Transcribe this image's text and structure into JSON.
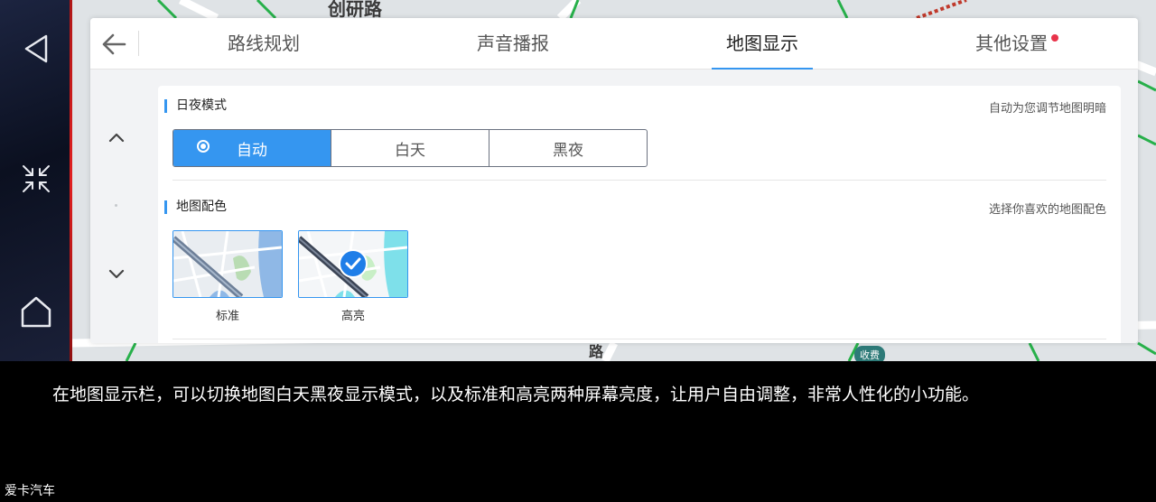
{
  "map": {
    "road_label_top": "创研路",
    "road_label_bottom": "路",
    "toll_badge": "收费"
  },
  "sidebar": {
    "buttons": [
      {
        "icon": "back-triangle-icon"
      },
      {
        "icon": "shrink-arrows-icon"
      },
      {
        "icon": "home-icon"
      }
    ]
  },
  "header": {
    "back_icon": "arrow-left-icon",
    "tabs": [
      {
        "label": "路线规划",
        "active": false
      },
      {
        "label": "声音播报",
        "active": false
      },
      {
        "label": "地图显示",
        "active": true
      },
      {
        "label": "其他设置",
        "active": false,
        "badge": "red-dot"
      }
    ]
  },
  "day_night": {
    "title": "日夜模式",
    "hint": "自动为您调节地图明暗",
    "options": [
      {
        "label": "自动",
        "selected": true
      },
      {
        "label": "白天",
        "selected": false
      },
      {
        "label": "黑夜",
        "selected": false
      }
    ]
  },
  "map_color": {
    "title": "地图配色",
    "hint": "选择你喜欢的地图配色",
    "themes": [
      {
        "label": "标准",
        "selected": false
      },
      {
        "label": "高亮",
        "selected": true
      }
    ]
  },
  "caption": "在地图显示栏，可以切换地图白天黑夜显示模式，以及标准和高亮两种屏幕亮度，让用户自由调整，非常人性化的小功能。",
  "watermark": "爱卡汽车",
  "colors": {
    "accent": "#3596f0",
    "badge_red": "#e8334a",
    "map_road_green": "#27b04a"
  }
}
